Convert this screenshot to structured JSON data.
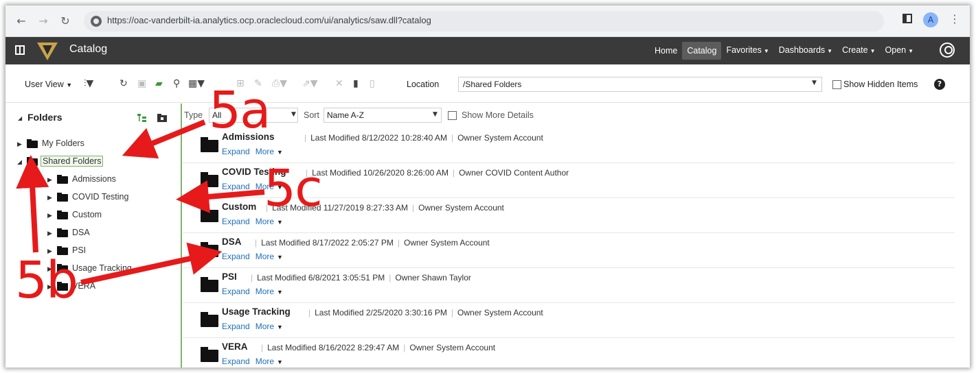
{
  "browser": {
    "url": "https://oac-vanderbilt-ia.analytics.ocp.oraclecloud.com/ui/analytics/saw.dll?catalog",
    "profile_initial": "A"
  },
  "app": {
    "title": "Catalog",
    "nav": [
      {
        "label": "Home",
        "caret": false,
        "active": false
      },
      {
        "label": "Catalog",
        "caret": false,
        "active": true
      },
      {
        "label": "Favorites",
        "caret": true,
        "active": false
      },
      {
        "label": "Dashboards",
        "caret": true,
        "active": false
      },
      {
        "label": "Create",
        "caret": true,
        "active": false
      },
      {
        "label": "Open",
        "caret": true,
        "active": false
      }
    ]
  },
  "toolbar": {
    "user_view_label": "User View",
    "location_label": "Location",
    "location_value": "/Shared Folders",
    "show_hidden_label": "Show Hidden Items"
  },
  "sidebar": {
    "title": "Folders",
    "my_folders": "My Folders",
    "shared_folders": "Shared Folders",
    "children": [
      "Admissions",
      "COVID Testing",
      "Custom",
      "DSA",
      "PSI",
      "Usage Tracking",
      "VERA"
    ]
  },
  "filters": {
    "type_label": "Type",
    "type_value": "All",
    "sort_label": "Sort",
    "sort_value": "Name A-Z",
    "more_details_label": "Show More Details"
  },
  "items": [
    {
      "name": "Admissions",
      "modified": "Last Modified 8/12/2022 10:28:40 AM",
      "owner": "Owner System Account"
    },
    {
      "name": "COVID Testing",
      "modified": "Last Modified 10/26/2020 8:26:00 AM",
      "owner": "Owner COVID Content Author"
    },
    {
      "name": "Custom",
      "modified": "Last Modified 11/27/2019 8:27:33 AM",
      "owner": "Owner System Account"
    },
    {
      "name": "DSA",
      "modified": "Last Modified 8/17/2022 2:05:27 PM",
      "owner": "Owner System Account"
    },
    {
      "name": "PSI",
      "modified": "Last Modified 6/8/2021 3:05:51 PM",
      "owner": "Owner Shawn Taylor"
    },
    {
      "name": "Usage Tracking",
      "modified": "Last Modified 2/25/2020 3:30:16 PM",
      "owner": "Owner System Account"
    },
    {
      "name": "VERA",
      "modified": "Last Modified 8/16/2022 8:29:47 AM",
      "owner": "Owner System Account"
    }
  ],
  "row_actions": {
    "expand": "Expand",
    "more": "More"
  },
  "annotations": {
    "a": "5a",
    "b": "5b",
    "c": "5c"
  },
  "colors": {
    "accent_green": "#7fb26a",
    "link_blue": "#1f6fb5",
    "header_dark": "#3a3a3a",
    "annotation_red": "#e61a1a"
  }
}
